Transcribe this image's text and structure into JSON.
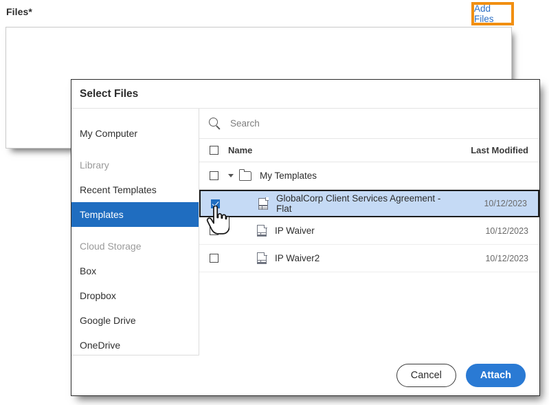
{
  "form": {
    "files_label": "Files",
    "required_marker": "*",
    "add_files_label": "Add Files",
    "highlight_color": "#f18f11",
    "add_files_text_color": "#2d6fc4"
  },
  "dialog": {
    "title": "Select Files",
    "sidebar": {
      "items": [
        {
          "label": "My Computer",
          "type": "item",
          "selected": false
        },
        {
          "label": "Library",
          "type": "group",
          "selected": false
        },
        {
          "label": "Recent Templates",
          "type": "item",
          "selected": false
        },
        {
          "label": "Templates",
          "type": "item",
          "selected": true
        },
        {
          "label": "Cloud Storage",
          "type": "group",
          "selected": false
        },
        {
          "label": "Box",
          "type": "item",
          "selected": false
        },
        {
          "label": "Dropbox",
          "type": "item",
          "selected": false
        },
        {
          "label": "Google Drive",
          "type": "item",
          "selected": false
        },
        {
          "label": "OneDrive",
          "type": "item",
          "selected": false
        }
      ],
      "selected_bg": "#1f6dc0"
    },
    "search": {
      "placeholder": "Search",
      "value": "",
      "icon": "search-icon"
    },
    "table": {
      "columns": {
        "name": "Name",
        "last_modified": "Last Modified"
      },
      "select_all_checked": false,
      "rows": [
        {
          "kind": "folder",
          "icon": "folder-icon",
          "name": "My Templates",
          "last_modified": "",
          "checked": false,
          "expanded": true,
          "selected": false
        },
        {
          "kind": "file",
          "icon": "document-icon",
          "name": "GlobalCorp Client Services Agreement - Flat",
          "last_modified": "10/12/2023",
          "checked": true,
          "selected": true
        },
        {
          "kind": "file",
          "icon": "document-icon",
          "name": "IP Waiver",
          "last_modified": "10/12/2023",
          "checked": false,
          "selected": false
        },
        {
          "kind": "file",
          "icon": "document-icon",
          "name": "IP Waiver2",
          "last_modified": "10/12/2023",
          "checked": false,
          "selected": false
        }
      ],
      "selected_row_bg": "#c5daf5",
      "checkbox_checked_color": "#1f6dc0"
    },
    "footer": {
      "cancel_label": "Cancel",
      "attach_label": "Attach",
      "attach_color": "#2a7ad4"
    }
  },
  "cursor": {
    "type": "pointing-hand-cursor"
  }
}
